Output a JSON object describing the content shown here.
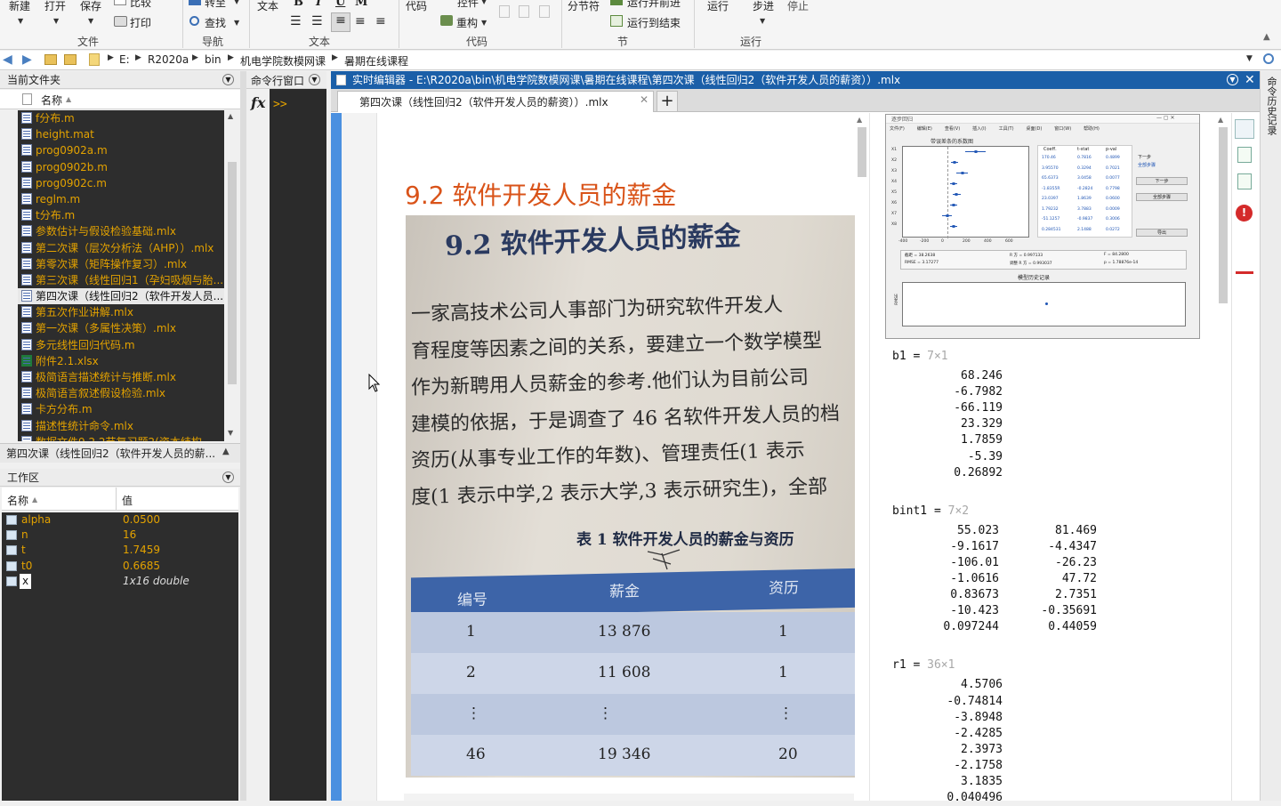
{
  "ribbon": {
    "file": {
      "new": "新建",
      "open": "打开",
      "save": "保存",
      "compare": "比较",
      "print": "打印",
      "section": "文件"
    },
    "nav": {
      "goto": "转至",
      "find": "查找",
      "section": "导航"
    },
    "text": {
      "text": "文本",
      "bold": "B",
      "italic": "I",
      "underline": "U",
      "mono": "M",
      "section": "文本"
    },
    "code": {
      "code": "代码",
      "control": "控件",
      "refactor": "重构",
      "section": "代码"
    },
    "sectionGroup": {
      "break": "分节符",
      "runAdvance": "运行并前进",
      "runToEnd": "运行到结束",
      "section": "节"
    },
    "run": {
      "run": "运行",
      "step": "步进",
      "stop": "停止",
      "section": "运行"
    }
  },
  "address": {
    "path": [
      "E:",
      "R2020a",
      "bin",
      "机电学院数模网课",
      "暑期在线课程"
    ]
  },
  "filePanel": {
    "title": "当前文件夹",
    "colName": "名称",
    "files": [
      {
        "name": "f分布.m",
        "type": "m"
      },
      {
        "name": "height.mat",
        "type": "mat"
      },
      {
        "name": "prog0902a.m",
        "type": "m"
      },
      {
        "name": "prog0902b.m",
        "type": "m"
      },
      {
        "name": "prog0902c.m",
        "type": "m"
      },
      {
        "name": "reglm.m",
        "type": "m"
      },
      {
        "name": "t分布.m",
        "type": "m"
      },
      {
        "name": "参数估计与假设检验基础.mlx",
        "type": "mlx"
      },
      {
        "name": "第二次课（层次分析法（AHP））.mlx",
        "type": "mlx"
      },
      {
        "name": "第零次课（矩阵操作复习）.mlx",
        "type": "mlx"
      },
      {
        "name": "第三次课（线性回归1（孕妇吸烟与胎...",
        "type": "mlx"
      },
      {
        "name": "第四次课（线性回归2（软件开发人员...",
        "type": "mlx",
        "selected": true
      },
      {
        "name": "第五次作业讲解.mlx",
        "type": "mlx"
      },
      {
        "name": "第一次课（多属性决策）.mlx",
        "type": "mlx"
      },
      {
        "name": "多元线性回归代码.m",
        "type": "m"
      },
      {
        "name": "附件2.1.xlsx",
        "type": "xlsx"
      },
      {
        "name": "极简语言描述统计与推断.mlx",
        "type": "mlx"
      },
      {
        "name": "极简语言叙述假设检验.mlx",
        "type": "mlx"
      },
      {
        "name": "卡方分布.m",
        "type": "m"
      },
      {
        "name": "描述性统计命令.mlx",
        "type": "mlx"
      },
      {
        "name": "数据文件9.2.2节复习题2(资本结构...",
        "type": "mat"
      }
    ],
    "detail": "第四次课（线性回归2（软件开发人员的薪..."
  },
  "workspace": {
    "title": "工作区",
    "colName": "名称",
    "colValue": "值",
    "vars": [
      {
        "name": "alpha",
        "value": "0.0500"
      },
      {
        "name": "n",
        "value": "16"
      },
      {
        "name": "t",
        "value": "1.7459"
      },
      {
        "name": "t0",
        "value": "0.6685"
      },
      {
        "name": "x",
        "value": "1x16 double"
      }
    ]
  },
  "command": {
    "title": "命令行窗口",
    "fx": "fx",
    "prompt": ">>"
  },
  "editor": {
    "title": "实时编辑器 - E:\\R2020a\\bin\\机电学院数模网课\\暑期在线课程\\第四次课（线性回归2（软件开发人员的薪资））.mlx",
    "tab": "第四次课（线性回归2（软件开发人员的薪资））.mlx",
    "heading": "9.2 软件开发人员的薪金",
    "photo": {
      "heading": "9.2  软件开发人员的薪金",
      "para": [
        "一家高技术公司人事部门为研究软件开发人",
        "育程度等因素之间的关系，要建立一个数学模型",
        "作为新聘用人员薪金的参考.他们认为目前公司",
        "建模的依据，于是调查了 46 名软件开发人员的档",
        "资历(从事专业工作的年数)、管理责任(1 表示",
        "度(1 表示中学,2 表示大学,3 表示研究生)，全部"
      ],
      "tableTitle": "表 1   软件开发人员的薪金与资历",
      "cols": [
        "编号",
        "薪金",
        "资历"
      ],
      "rows": [
        [
          "1",
          "13 876",
          "1"
        ],
        [
          "2",
          "11 608",
          "1"
        ],
        [
          "⋮",
          "⋮",
          "⋮"
        ],
        [
          "46",
          "19 346",
          "20"
        ]
      ]
    },
    "outputs": [
      {
        "name": "b1",
        "dims": "7×1",
        "rows": [
          "68.246",
          "-6.7982",
          "-66.119",
          "23.329",
          "1.7859",
          "-5.39",
          "0.26892"
        ]
      },
      {
        "name": "bint1",
        "dims": "7×2",
        "rows": [
          [
            "55.023",
            "81.469"
          ],
          [
            "-9.1617",
            "-4.4347"
          ],
          [
            "-106.01",
            "-26.23"
          ],
          [
            "-1.0616",
            "47.72"
          ],
          [
            "0.83673",
            "2.7351"
          ],
          [
            "-10.423",
            "-0.35691"
          ],
          [
            "0.097244",
            "0.44059"
          ]
        ]
      },
      {
        "name": "r1",
        "dims": "36×1",
        "rows": [
          "4.5706",
          "-0.74814",
          "-3.8948",
          "-2.4285",
          "2.3973",
          "-2.1758",
          "3.1835",
          "0.040496"
        ]
      }
    ],
    "stepwise": {
      "title": "逐步回归",
      "menu": [
        "文件(F)",
        "编辑(E)",
        "查看(V)",
        "插入(I)",
        "工具(T)",
        "桌面(D)",
        "窗口(W)",
        "帮助(H)"
      ],
      "plotTitle": "带误差条的系数图",
      "colHead": [
        "Coeff.",
        "t-stat",
        "p-val"
      ],
      "coefRows": [
        [
          "170.46",
          "0.7816",
          "0.4899"
        ],
        [
          "3.95570",
          "0.3294",
          "0.7021"
        ],
        [
          "65.6373",
          "3.0458",
          "0.0077"
        ],
        [
          "-1.8355R",
          "-0.2824",
          "0.7798"
        ],
        [
          "23.0397",
          "1.8639",
          "0.0600"
        ],
        [
          "1.79232",
          "3.7883",
          "0.0009"
        ],
        [
          "-51.1257",
          "-0.9837",
          "0.3006"
        ],
        [
          "0.284531",
          "2.1488",
          "0.0272"
        ]
      ],
      "xticks": [
        "-400",
        "-200",
        "0",
        "200",
        "400",
        "600"
      ],
      "ylabels": [
        "X1",
        "X2",
        "X3",
        "X4",
        "X5",
        "X6",
        "X7",
        "X8"
      ],
      "nextStep": "下一步",
      "allSteps": "全部步骤",
      "btnNext": "下一步",
      "btnAll": "全部步骤",
      "export": "导出",
      "stats": [
        "截距 = 38.2638",
        "R 方 = 0.997133",
        "F = 84.2800",
        "RMSE = 3.17277",
        "调整 R 方 = 0.993037",
        "p = 1.78876e-14"
      ],
      "historyTitle": "模型历史记录",
      "historyY": "RMSE"
    }
  },
  "rightbar": {
    "label": "命令历史记录"
  }
}
